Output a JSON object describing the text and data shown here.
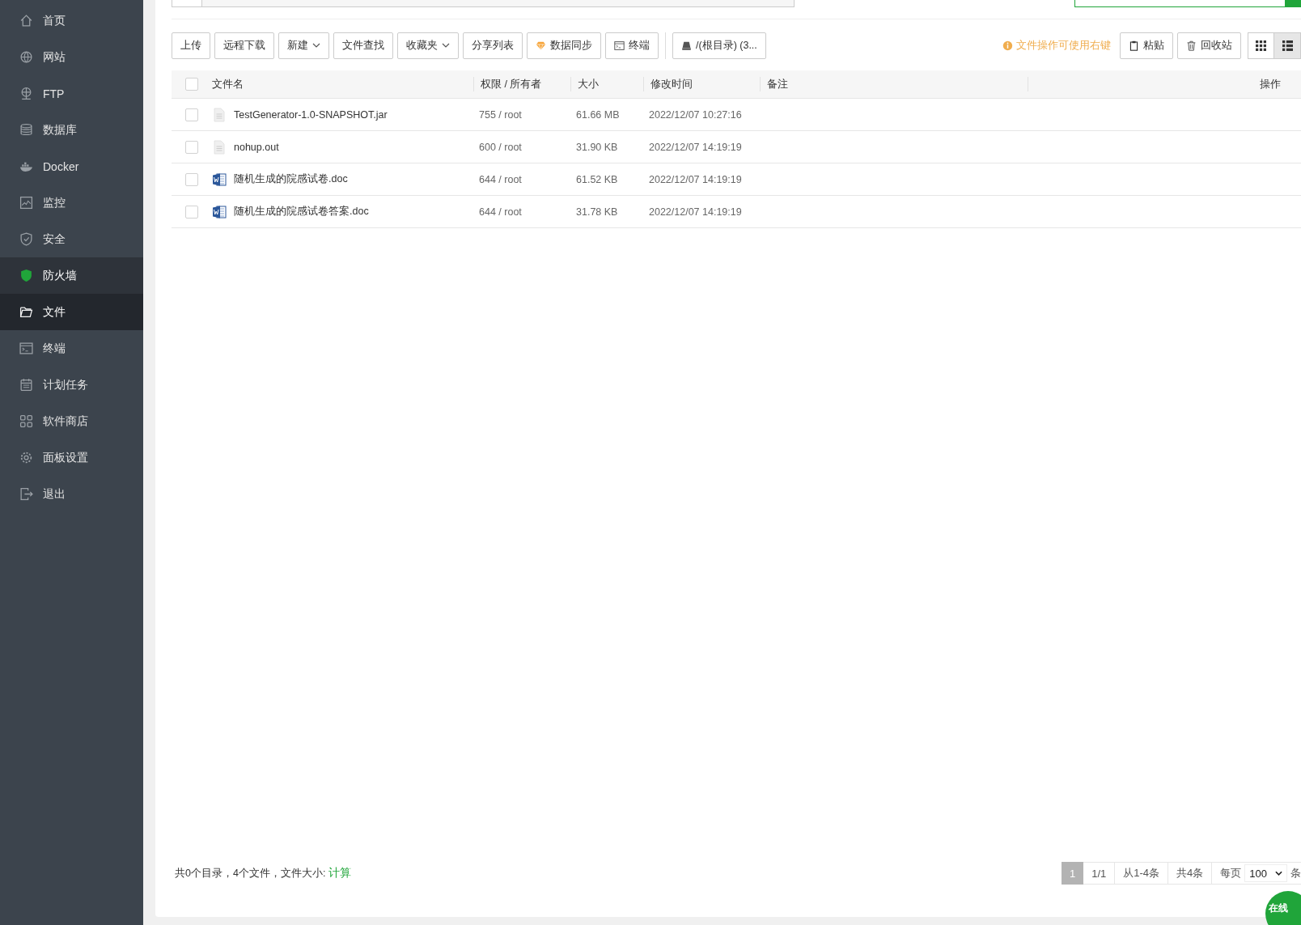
{
  "sidebar": {
    "items": [
      {
        "label": "首页",
        "kind": "home",
        "selected": false,
        "hover": false
      },
      {
        "label": "网站",
        "kind": "globe",
        "selected": false,
        "hover": false
      },
      {
        "label": "FTP",
        "kind": "ftp",
        "selected": false,
        "hover": false
      },
      {
        "label": "数据库",
        "kind": "database",
        "selected": false,
        "hover": false
      },
      {
        "label": "Docker",
        "kind": "whale",
        "selected": false,
        "hover": false
      },
      {
        "label": "监控",
        "kind": "monitor",
        "selected": false,
        "hover": false
      },
      {
        "label": "安全",
        "kind": "shield",
        "selected": false,
        "hover": false
      },
      {
        "label": "防火墙",
        "kind": "shield",
        "selected": false,
        "hover": true
      },
      {
        "label": "文件",
        "kind": "folder",
        "selected": true,
        "hover": false
      },
      {
        "label": "终端",
        "kind": "terminal",
        "selected": false,
        "hover": false
      },
      {
        "label": "计划任务",
        "kind": "calendar",
        "selected": false,
        "hover": false
      },
      {
        "label": "软件商店",
        "kind": "grid",
        "selected": false,
        "hover": false
      },
      {
        "label": "面板设置",
        "kind": "gear",
        "selected": false,
        "hover": false
      },
      {
        "label": "退出",
        "kind": "exit",
        "selected": false,
        "hover": false
      }
    ]
  },
  "toolbar": {
    "left": [
      {
        "label": "上传",
        "kind": "plain"
      },
      {
        "label": "远程下载",
        "kind": "plain"
      },
      {
        "label": "新建",
        "kind": "dropdown"
      },
      {
        "label": "文件查找",
        "kind": "plain"
      },
      {
        "label": "收藏夹",
        "kind": "dropdown"
      },
      {
        "label": "分享列表",
        "kind": "plain"
      },
      {
        "label": "数据同步",
        "kind": "gem"
      },
      {
        "label": "终端",
        "kind": "terminal"
      },
      {
        "label": "/(根目录) (3...",
        "kind": "disk"
      }
    ],
    "hint": "文件操作可使用右键",
    "right": [
      {
        "label": "粘贴",
        "kind": "clipboard"
      },
      {
        "label": "回收站",
        "kind": "trash"
      }
    ],
    "views": [
      {
        "kind": "grid",
        "selected": false
      },
      {
        "kind": "list",
        "selected": true
      }
    ]
  },
  "table": {
    "columns": [
      "文件名",
      "权限 / 所有者",
      "大小",
      "修改时间",
      "备注",
      "操作"
    ],
    "all_checked": false,
    "rows": [
      {
        "kind": "file",
        "name": "TestGenerator-1.0-SNAPSHOT.jar",
        "perm": "755 / root",
        "size": "61.66 MB",
        "time": "2022/12/07 10:27:16",
        "checked": false
      },
      {
        "kind": "file",
        "name": "nohup.out",
        "perm": "600 / root",
        "size": "31.90 KB",
        "time": "2022/12/07 14:19:19",
        "checked": false
      },
      {
        "kind": "word",
        "name": "随机生成的院感试卷.doc",
        "perm": "644 / root",
        "size": "61.52 KB",
        "time": "2022/12/07 14:19:19",
        "checked": false
      },
      {
        "kind": "word",
        "name": "随机生成的院感试卷答案.doc",
        "perm": "644 / root",
        "size": "31.78 KB",
        "time": "2022/12/07 14:19:19",
        "checked": false
      }
    ]
  },
  "footer": {
    "summary": "共0个目录，4个文件，文件大小:",
    "calc_link": "计算",
    "pages": [
      {
        "label": "1",
        "selected": true
      },
      {
        "label": "1/1",
        "selected": false
      },
      {
        "label": "从1-4条",
        "selected": false
      },
      {
        "label": "共4条",
        "selected": false
      }
    ],
    "per_page_label": "每页",
    "per_page": "100",
    "unit": "条"
  },
  "chat_button": "在线"
}
